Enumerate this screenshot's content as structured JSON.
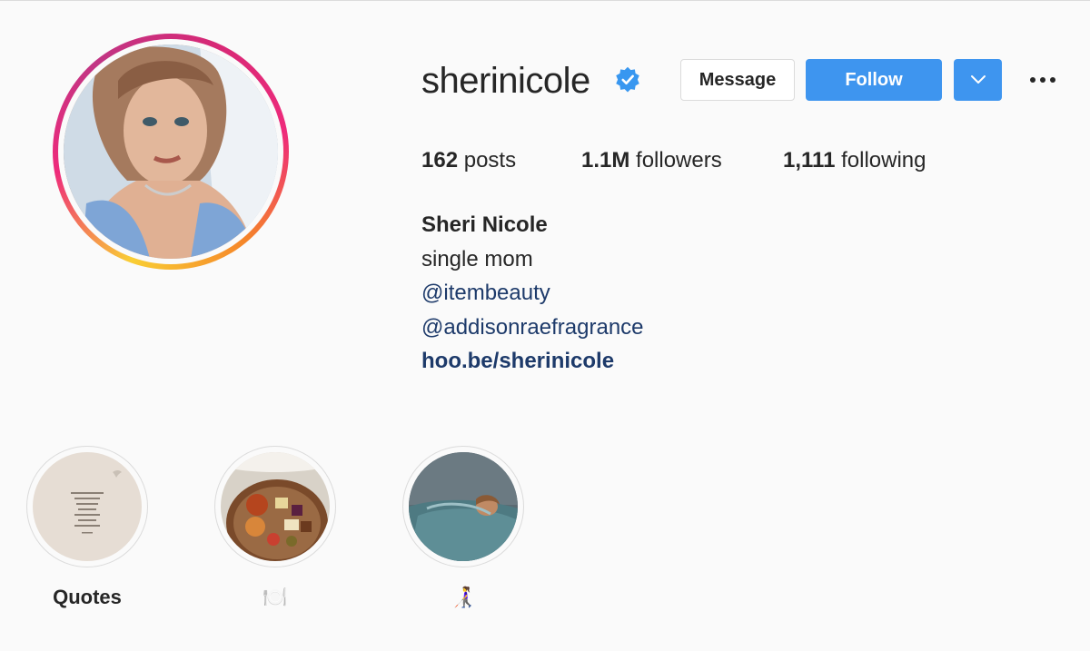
{
  "profile": {
    "username": "sherinicole",
    "verified": true,
    "verified_icon": "verified-badge-icon",
    "avatar_icon": "profile-photo"
  },
  "actions": {
    "message_label": "Message",
    "follow_label": "Follow",
    "dropdown_icon": "chevron-down-icon",
    "more_icon": "more-options-icon"
  },
  "stats": {
    "posts_count": "162",
    "posts_label": " posts",
    "followers_count": "1.1M",
    "followers_label": " followers",
    "following_count": "1,111",
    "following_label": " following"
  },
  "bio": {
    "full_name": "Sheri Nicole",
    "line1": "single mom",
    "mention1": "@itembeauty",
    "mention2": "@addisonraefragrance",
    "link": "hoo.be/sherinicole"
  },
  "highlights": [
    {
      "label": "Quotes"
    },
    {
      "label": "🍽️"
    },
    {
      "label": "👩‍🦯"
    }
  ],
  "colors": {
    "accent_blue": "#3e95ef",
    "link_blue": "#1d3a6a",
    "background": "#fafafa",
    "text": "#262626"
  }
}
